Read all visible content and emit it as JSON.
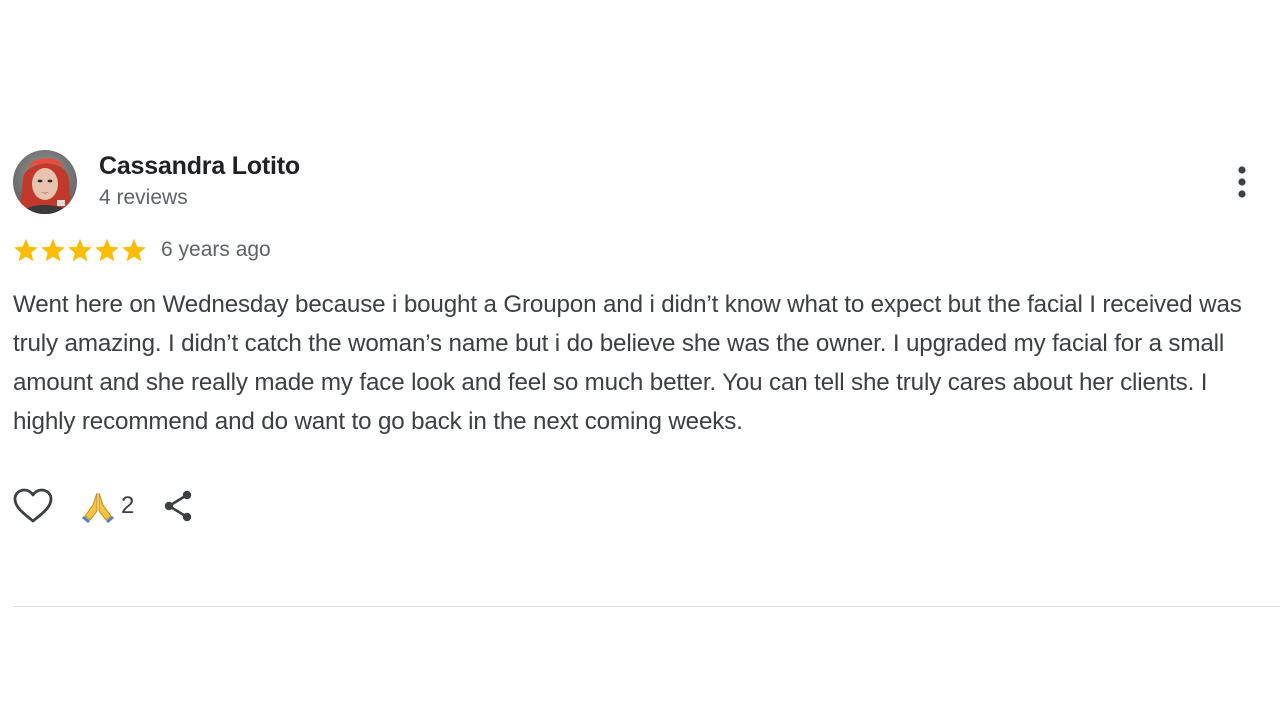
{
  "reviewer": {
    "name": "Cassandra Lotito",
    "review_count": "4 reviews",
    "avatar_icon": "reviewer-avatar-photo"
  },
  "rating": {
    "stars": 5,
    "max_stars": 5,
    "star_color": "#fbbc04",
    "date": "6 years ago"
  },
  "review": {
    "text": "Went here on Wednesday because i bought a Groupon and i didn’t know what to expect but the facial I received was truly amazing. I didn’t catch the woman’s name but i do believe she was the owner. I upgraded my facial for a small amount and she really made my face look and feel so much better. You can tell she truly cares about her clients. I highly recommend and do want to go back in the next coming weeks."
  },
  "actions": {
    "like_icon": "heart-outline-icon",
    "reaction_icon": "folded-hands-icon",
    "reaction_count": "2",
    "share_icon": "share-icon",
    "more_icon": "more-vertical-icon"
  },
  "colors": {
    "name": "#202124",
    "secondary_text": "#5f6368",
    "body_text": "#3c4043",
    "divider": "#dadce0"
  }
}
